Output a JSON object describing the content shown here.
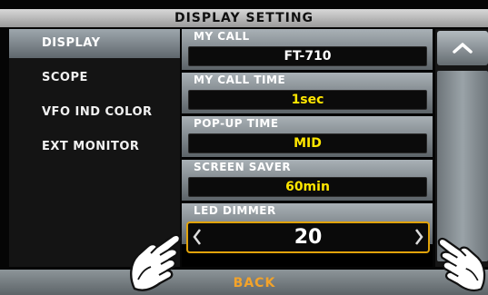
{
  "title": "DISPLAY SETTING",
  "sidebar": {
    "items": [
      {
        "label": "DISPLAY",
        "active": true
      },
      {
        "label": "SCOPE",
        "active": false
      },
      {
        "label": "VFO IND COLOR",
        "active": false
      },
      {
        "label": "EXT MONITOR",
        "active": false
      }
    ]
  },
  "settings": [
    {
      "label": "MY CALL",
      "value": "FT-710",
      "value_color": "#ffffff"
    },
    {
      "label": "MY CALL TIME",
      "value": "1sec",
      "value_color": "#ffe600"
    },
    {
      "label": "POP-UP TIME",
      "value": "MID",
      "value_color": "#ffe600"
    },
    {
      "label": "SCREEN SAVER",
      "value": "60min",
      "value_color": "#ffe600"
    },
    {
      "label": "LED DIMMER"
    }
  ],
  "editor": {
    "value": "20"
  },
  "bottom": {
    "back_label": "BACK"
  },
  "colors": {
    "accent": "#e0a20a",
    "value_yellow": "#ffe600",
    "back_orange": "#f3a32a"
  },
  "icons": {
    "scroll_up": "chevron-up-icon",
    "decrease": "chevron-left-icon",
    "increase": "chevron-right-icon",
    "touch_hands": "touch-hand-icon"
  }
}
